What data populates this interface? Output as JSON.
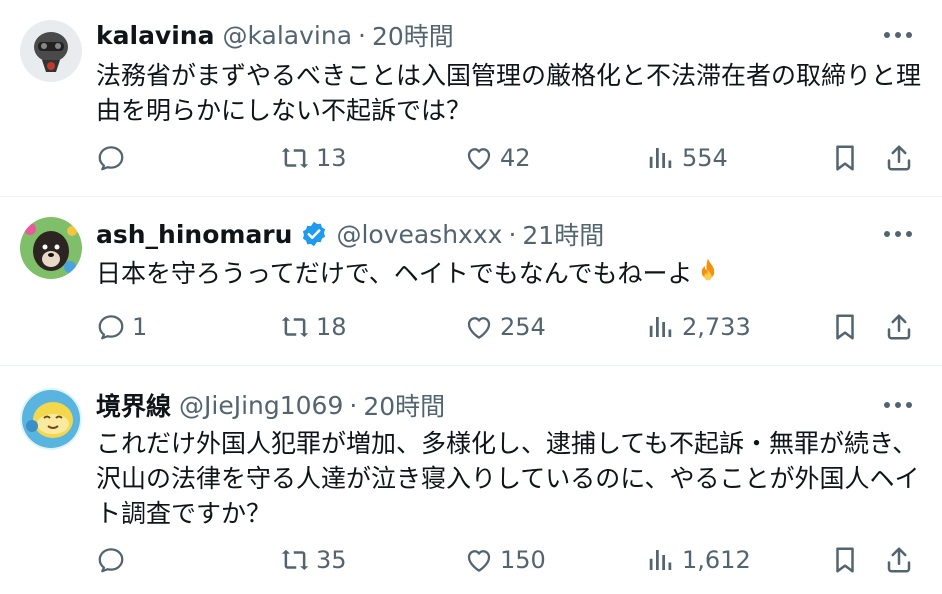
{
  "tweets": [
    {
      "name": "kalavina",
      "handle": "@kalavina",
      "dot": "·",
      "time": "20時間",
      "verified": false,
      "text": "法務省がまずやるべきことは入国管理の厳格化と不法滞在者の取締りと理由を明らかにしない不起訴では？",
      "replies": "",
      "retweets": "13",
      "likes": "42",
      "views": "554"
    },
    {
      "name": "ash_hinomaru",
      "handle": "@loveashxxx",
      "dot": "·",
      "time": "21時間",
      "verified": true,
      "text": "日本を守ろうってだけで、ヘイトでもなんでもねーよ",
      "emoji": "fire",
      "replies": "1",
      "retweets": "18",
      "likes": "254",
      "views": "2,733"
    },
    {
      "name": "境界線",
      "handle": "@JieJing1069",
      "dot": "·",
      "time": "20時間",
      "verified": false,
      "text": "これだけ外国人犯罪が増加、多様化し、逮捕しても不起訴・無罪が続き、沢山の法律を守る人達が泣き寝入りしているのに、やることが外国人ヘイト調査ですか？",
      "replies": "",
      "retweets": "35",
      "likes": "150",
      "views": "1,612"
    }
  ],
  "colors": {
    "text": "#0f1419",
    "secondary": "#536471",
    "verified": "#1d9bf0",
    "divider": "#eff3f4"
  }
}
